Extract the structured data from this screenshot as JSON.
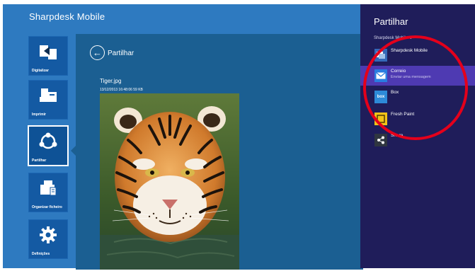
{
  "app": {
    "title": "Sharpdesk Mobile"
  },
  "nav": {
    "items": [
      {
        "label": "Digitalizar"
      },
      {
        "label": "Imprimir"
      },
      {
        "label": "Partilhar"
      },
      {
        "label": "Organizar ficheiro"
      },
      {
        "label": "Definições"
      }
    ]
  },
  "content": {
    "title": "Partilhar",
    "file_name": "Tiger.jpg",
    "file_meta": "13/12/2013 16:48:06  59 KB"
  },
  "share_panel": {
    "title": "Partilhar",
    "app_name": "Sharpdesk Mobile ⌄",
    "items": [
      {
        "label": "Sharpdesk Mobile",
        "icon": "sharpdesk-icon"
      },
      {
        "label": "Correio",
        "sub": "Enviar uma mensagem",
        "icon": "mail-icon"
      },
      {
        "label": "Box",
        "icon": "box-icon",
        "icon_text": "box"
      },
      {
        "label": "Fresh Paint",
        "icon": "fresh-paint-icon"
      },
      {
        "label": "Share",
        "icon": "share-app-icon"
      }
    ]
  },
  "colors": {
    "app_bg": "#2e7ac0",
    "tile_bg": "#145aa3",
    "content_bg": "#1b5f92",
    "charm_bg": "#1f1d5a",
    "highlight": "#4e3ab2",
    "annotation_ring": "#e4001b"
  }
}
